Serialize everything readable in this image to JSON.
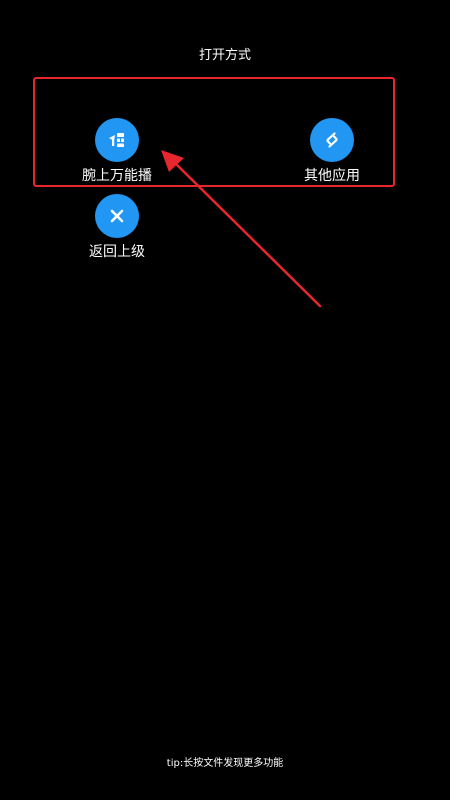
{
  "dialog": {
    "title": "打开方式",
    "tip": "tip:长按文件发现更多功能"
  },
  "options": [
    {
      "label": "腕上万能播",
      "icon": "app-logo-icon",
      "color": "#2196f3"
    },
    {
      "label": "其他应用",
      "icon": "share-app-icon",
      "color": "#2196f3"
    },
    {
      "label": "返回上级",
      "icon": "close-icon",
      "color": "#2196f3"
    }
  ],
  "annotation": {
    "highlight_color": "#e8262d",
    "arrow_color": "#e8262d"
  }
}
